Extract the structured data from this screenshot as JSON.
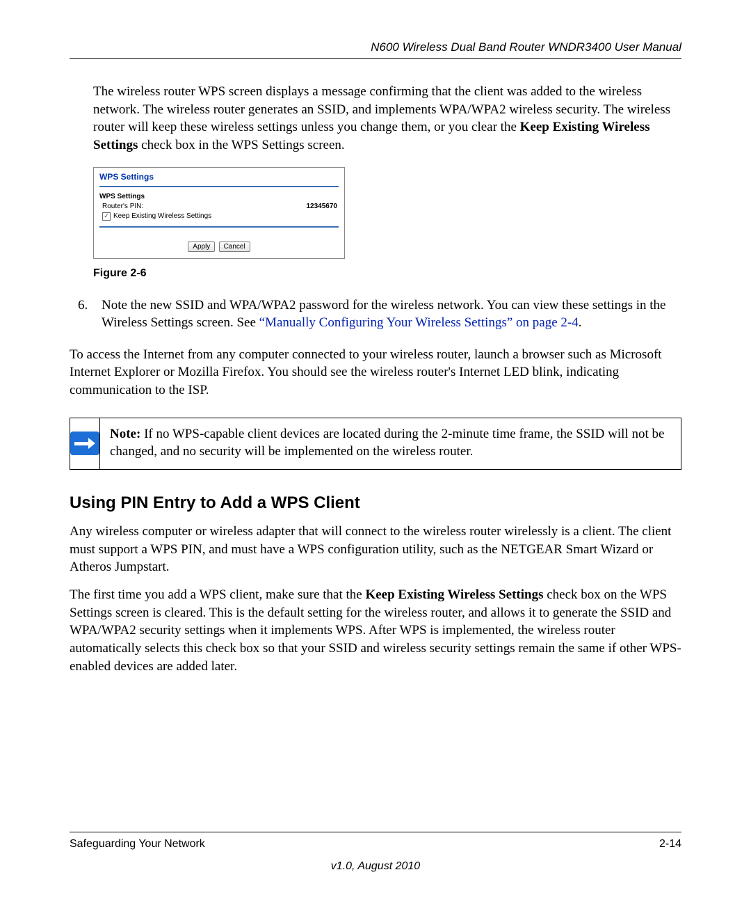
{
  "header": {
    "title": "N600 Wireless Dual Band Router WNDR3400 User Manual"
  },
  "intro": {
    "text_pre": "The wireless router WPS screen displays a message confirming that the client was added to the wireless network. The wireless router generates an SSID, and implements WPA/WPA2 wireless security. The wireless router will keep these wireless settings unless you change them, or you clear the ",
    "bold": "Keep Existing Wireless Settings",
    "text_post": " check box in the WPS Settings screen."
  },
  "figure": {
    "panel_title": "WPS Settings",
    "subheading": "WPS Settings",
    "pin_label": "Router's PIN:",
    "pin_value": "12345670",
    "checkbox_label": "Keep Existing Wireless Settings",
    "checkbox_checked": true,
    "apply": "Apply",
    "cancel": "Cancel",
    "caption": "Figure 2-6"
  },
  "step6": {
    "number": "6.",
    "text_pre": "Note the new SSID and WPA/WPA2 password for the wireless network. You can view these settings in the Wireless Settings screen. See ",
    "link": "“Manually Configuring Your Wireless Settings” on page 2-4",
    "text_post": "."
  },
  "access_para": "To access the Internet from any computer connected to your wireless router, launch a browser such as Microsoft Internet Explorer or Mozilla Firefox. You should see the wireless router's Internet LED blink, indicating communication to the ISP.",
  "note": {
    "label": "Note:",
    "text": " If no WPS-capable client devices are located during the 2-minute time frame, the SSID will not be changed, and no security will be implemented on the wireless router."
  },
  "section_heading": "Using PIN Entry to Add a WPS Client",
  "para1": "Any wireless computer or wireless adapter that will connect to the wireless router wirelessly is a client. The client must support a WPS PIN, and must have a WPS configuration utility, such as the NETGEAR Smart Wizard or Atheros Jumpstart.",
  "para2_pre": "The first time you add a WPS client, make sure that the ",
  "para2_bold": "Keep Existing Wireless Settings",
  "para2_post": " check box on the WPS Settings screen is cleared. This is the default setting for the wireless router, and allows it to generate the SSID and WPA/WPA2 security settings when it implements WPS. After WPS is implemented, the wireless router automatically selects this check box so that your SSID and wireless security settings remain the same if other WPS-enabled devices are added later.",
  "footer": {
    "left": "Safeguarding Your Network",
    "right": "2-14",
    "version": "v1.0, August 2010"
  }
}
